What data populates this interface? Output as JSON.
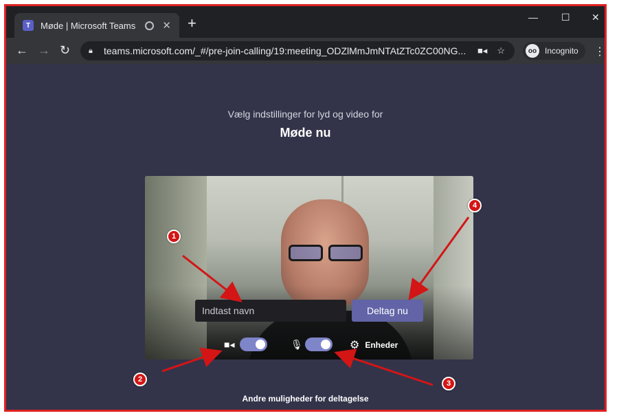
{
  "colors": {
    "page_bg": "#33344a",
    "accent_button": "#6264a7",
    "toggle_on": "#7f85c9",
    "annotation_red": "#d31515"
  },
  "browser": {
    "tab": {
      "favicon_letter": "T",
      "title": "Møde | Microsoft Teams",
      "recording_icon": "record-icon",
      "close_symbol": "✕"
    },
    "new_tab_symbol": "+",
    "window_controls": {
      "minimize": "—",
      "maximize": "☐",
      "close": "✕"
    },
    "nav": {
      "back": "←",
      "forward": "→",
      "reload": "↻"
    },
    "url": "teams.microsoft.com/_#/pre-join-calling/19:meeting_ODZlMmJmNTAtZTc0ZC00NG...",
    "incognito_label": "Incognito",
    "menu_symbol": "⋮"
  },
  "prejoin": {
    "subtitle": "Vælg indstillinger for lyd og video for",
    "meeting_title": "Møde nu",
    "name_placeholder": "Indtast navn",
    "name_value": "",
    "join_button": "Deltag nu",
    "camera_toggle_on": true,
    "mic_toggle_on": true,
    "devices_label": "Enheder",
    "other_options": "Andre muligheder for deltagelse"
  },
  "annotations": [
    "1",
    "2",
    "3",
    "4"
  ]
}
